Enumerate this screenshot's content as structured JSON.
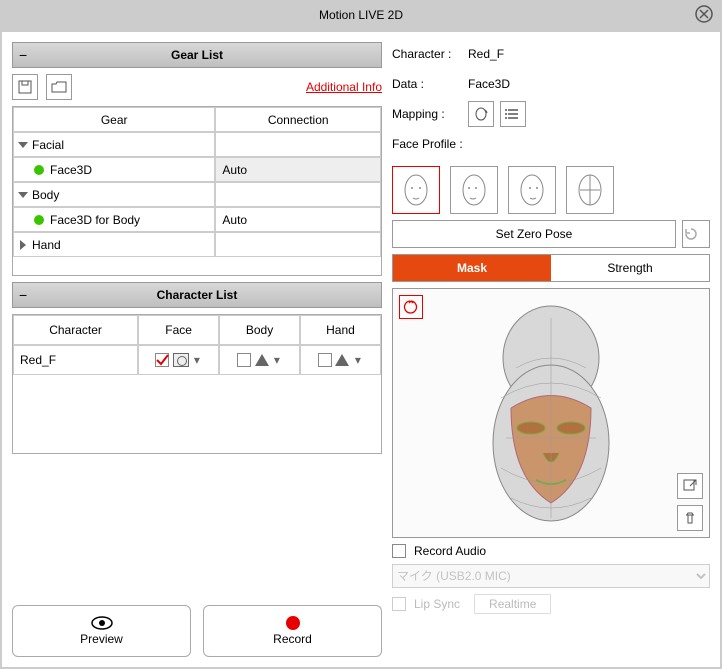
{
  "window": {
    "title": "Motion LIVE 2D"
  },
  "left": {
    "gear": {
      "header": "Gear List",
      "additional": "Additional Info",
      "columns": [
        "Gear",
        "Connection"
      ],
      "groups": [
        {
          "name": "Facial",
          "open": true,
          "items": [
            {
              "name": "Face3D",
              "connection": "Auto"
            }
          ]
        },
        {
          "name": "Body",
          "open": true,
          "items": [
            {
              "name": "Face3D for Body",
              "connection": "Auto"
            }
          ]
        },
        {
          "name": "Hand",
          "open": false,
          "items": []
        }
      ]
    },
    "characters": {
      "header": "Character List",
      "columns": [
        "Character",
        "Face",
        "Body",
        "Hand"
      ],
      "rows": [
        {
          "name": "Red_F"
        }
      ]
    },
    "buttons": {
      "preview": "Preview",
      "record": "Record"
    }
  },
  "right": {
    "character_label": "Character :",
    "character_value": "Red_F",
    "data_label": "Data :",
    "data_value": "Face3D",
    "mapping_label": "Mapping :",
    "faceprofile_label": "Face Profile :",
    "zero": "Set Zero Pose",
    "tabs": {
      "mask": "Mask",
      "strength": "Strength"
    },
    "record_audio": "Record Audio",
    "mic_placeholder": "マイク (USB2.0 MIC)",
    "lipsync": "Lip Sync",
    "lipsync_mode": "Realtime"
  }
}
